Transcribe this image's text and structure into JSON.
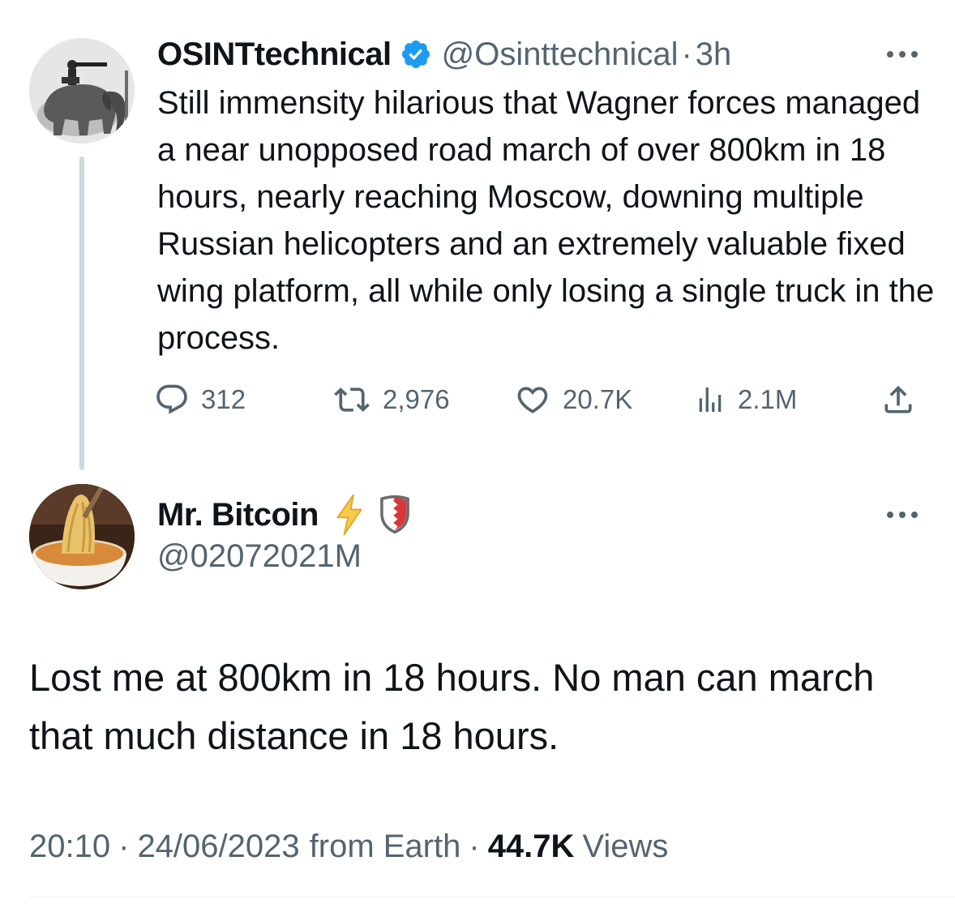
{
  "parent_tweet": {
    "display_name": "OSINTtechnical",
    "handle": "@Osinttechnical",
    "dot": "·",
    "time": "3h",
    "verified_badge_color": "#1d9bf0",
    "avatar_icon": "elephant-photo",
    "text": "Still immensity hilarious that Wagner forces managed a near unopposed road march of over 800km in 18 hours, nearly reaching Moscow, downing multiple Russian helicopters and an extremely valuable fixed wing platform, all while only losing a single truck in the process.",
    "actions": {
      "replies": "312",
      "retweets": "2,976",
      "likes": "20.7K",
      "views": "2.1M"
    }
  },
  "reply_tweet": {
    "display_name": "Mr. Bitcoin",
    "handle": "@02072021M",
    "avatar_icon": "noodles-photo",
    "name_icons": [
      "lightning-bolt-icon",
      "bahrain-shield-icon"
    ],
    "text": "Lost me at 800km in 18 hours. No man can march that much distance in 18 hours.",
    "time": "20:10",
    "date": "24/06/2023",
    "source": "from Earth",
    "sep": "·",
    "views_count": "44.7K",
    "views_label": "Views"
  },
  "colors": {
    "text_primary": "#0f1419",
    "text_secondary": "#536471",
    "thread_line": "#cfd9de",
    "verified": "#1d9bf0",
    "bolt": "#f7c948"
  }
}
